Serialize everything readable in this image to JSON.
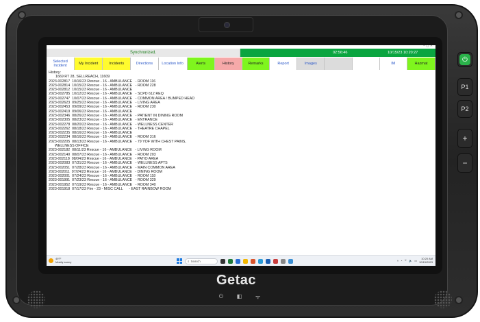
{
  "device": {
    "brand": "Getac",
    "side_buttons": [
      "P1",
      "P2",
      "+",
      "−"
    ]
  },
  "app": {
    "status": {
      "sync_text": "Synchronized.",
      "time": "02:56:46",
      "datetime": "10/15/23 10:20:27"
    },
    "tabs": [
      {
        "label": "Selected Incident",
        "bg": "#ffffff",
        "color": "#2a57c8"
      },
      {
        "label": "My Incident",
        "bg": "#fffb2e",
        "color": "#222222"
      },
      {
        "label": "Incidents",
        "bg": "#fffb2e",
        "color": "#222222"
      },
      {
        "label": "Directions",
        "bg": "#ffffff",
        "color": "#2a57c8"
      },
      {
        "label": "Location Info",
        "bg": "#ffffff",
        "color": "#2a57c8"
      },
      {
        "label": "Alerts",
        "bg": "#7ff51e",
        "color": "#222222"
      },
      {
        "label": "History",
        "bg": "#f6a9a9",
        "color": "#222222"
      },
      {
        "label": "Remarks",
        "bg": "#7ff51e",
        "color": "#222222"
      },
      {
        "label": "Report",
        "bg": "#ffffff",
        "color": "#2a57c8"
      },
      {
        "label": "Images",
        "bg": "#dcdcdc",
        "color": "#2a57c8"
      },
      {
        "label": "",
        "bg": "#dcdcdc",
        "color": "#222222"
      },
      {
        "label": "",
        "bg": "#ffffff",
        "color": "#222222"
      },
      {
        "label": "IM",
        "bg": "#ffffff",
        "color": "#2a57c8"
      },
      {
        "label": "Hazmat",
        "bg": "#7ff51e",
        "color": "#222222"
      }
    ],
    "history": {
      "heading": "History:",
      "address": "1669 RT 28, SELLREACH, 11609",
      "entries": [
        "2023-002817  10/16/23 Rescue - 16 - AMBULANCE   - ROOM 116",
        "2023-002814  10/15/23 Rescue - 16 - AMBULANCE   - ROOM 228",
        "2023-002812  10/15/23 Rescue - 16 - AMBULANCE",
        "2023-002785  10/12/23 Rescue - 16 - AMBULANCE   - SCPD 612 REQ",
        "2023-002747  10/07/23 Rescue - 16 - AMBULANCE   - COMMON AREA / BUMPED HEAD",
        "2023-002623  09/25/23 Rescue - 16 - AMBULANCE   - LIVING AREA",
        "2023-002453  09/09/23 Rescue - 16 - AMBULANCE   - ROOM 230",
        "2023-002419  09/06/23 Rescue - 16 - AMBULANCE",
        "2023-002346  08/26/23 Rescue - 16 - AMBULANCE   - PATIENT IN DINING ROOM",
        "2023-002305  08/23/23 Rescue - 16 - AMBULANCE   - ENTRANCE",
        "2023-002278  08/20/23 Rescue - 16 - AMBULANCE   - WELLNESS CENTER",
        "2023-002262  08/18/23 Rescue - 16 - AMBULANCE   - THEATRE CHAPEL",
        "2023-002235  08/16/23 Rescue - 16 - AMBULANCE",
        "2023-002234  08/16/23 Rescue - 16 - AMBULANCE   - ROOM 316",
        "2023-002205  08/13/23 Rescue - 16 - AMBULANCE   - 79 YOF WITH CHEST PAINS,",
        "      WELLNESS OFFICE",
        "2023-002182  08/11/23 Rescue - 16 - AMBULANCE   - LIVING ROOM",
        "2023-002140  08/07/23 Rescue - 16 - AMBULANCE   - ROOM 203",
        "2023-002118  08/04/23 Rescue - 16 - AMBULANCE   - PATIO AREA",
        "2023-002083  07/31/23 Rescue - 16 - AMBULANCE   - WELLNESS APTS",
        "2023-002051  07/28/23 Rescue - 16 - AMBULANCE   - MAIN COMMON AREA",
        "2023-002011  07/24/23 Rescue - 16 - AMBULANCE   - DINING ROOM",
        "2023-002001  07/24/23 Rescue - 16 - AMBULANCE   - ROOM 118",
        "2023-001991  07/23/23 Rescue - 16 - AMBULANCE   - ROOM 329",
        "2023-001952  07/19/23 Rescue - 16 - AMBULANCE   - ROOM 340",
        "2023-001918  07/17/23 Fire - 23 - MISC CALL      - EAST RAINBOW ROOM"
      ]
    }
  },
  "taskbar": {
    "weather_temp": "49°F",
    "weather_desc": "Mostly sunny",
    "search_placeholder": "Search",
    "time": "10:20 AM",
    "date": "10/15/2023",
    "app_icon_colors": [
      "#333333",
      "#1f7a3a",
      "#2b6fd6",
      "#f2b600",
      "#d9542b",
      "#2a9bd8",
      "#1a5fb4",
      "#c83c3c",
      "#888888",
      "#3b8fd4"
    ]
  }
}
